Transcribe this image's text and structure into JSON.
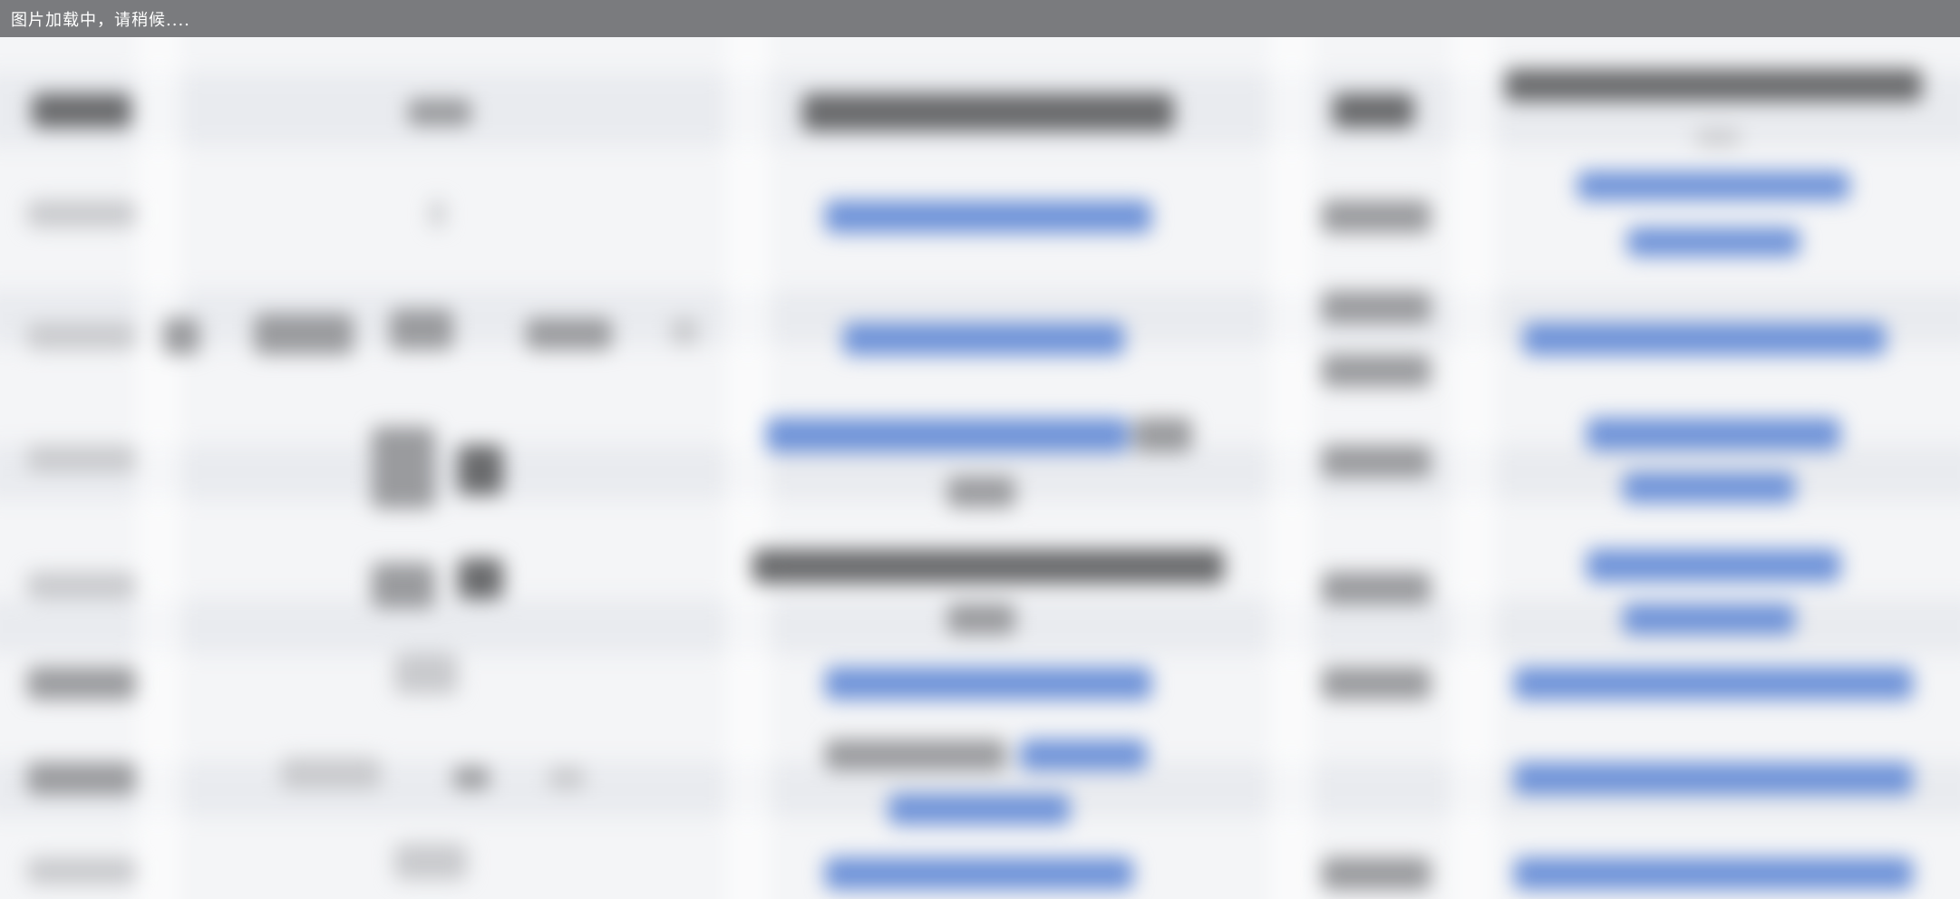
{
  "loading_text": "图片加载中，请稍候....",
  "colors": {
    "loading_bar": "#7a7b7e",
    "background": "#f4f5f7",
    "link_blue": "#6f93d8",
    "text_gray": "#6a6b6d"
  }
}
